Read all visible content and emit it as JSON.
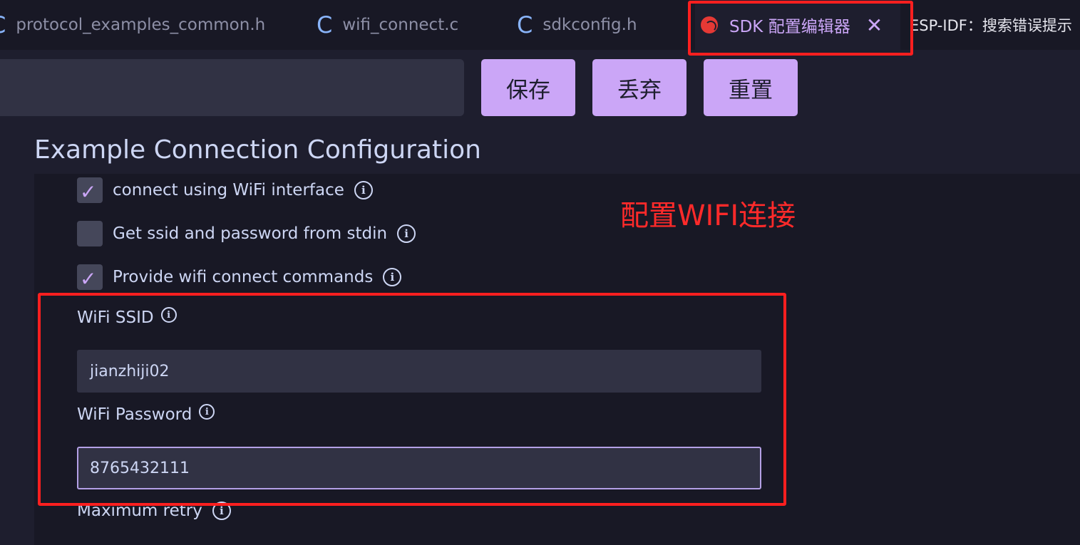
{
  "tabs": [
    {
      "label": "protocol_examples_common.h",
      "icon": "c-file-icon"
    },
    {
      "label": "wifi_connect.c",
      "icon": "c-file-icon"
    },
    {
      "label": "sdkconfig.h",
      "icon": "c-file-icon"
    },
    {
      "label": "SDK 配置编辑器",
      "icon": "espressif-icon",
      "active": true,
      "close_symbol": "✕"
    }
  ],
  "right_tab_label": "ESP-IDF：搜索错误提示",
  "toolbar": {
    "search_value": "",
    "save_label": "保存",
    "discard_label": "丢弃",
    "reset_label": "重置"
  },
  "section": {
    "title": "Example Connection Configuration",
    "options": [
      {
        "label": "connect using WiFi interface",
        "checked": true
      },
      {
        "label": "Get ssid and password from stdin",
        "checked": false
      },
      {
        "label": "Provide wifi connect commands",
        "checked": true
      }
    ],
    "ssid": {
      "label": "WiFi SSID",
      "value": "jianzhiji02"
    },
    "password": {
      "label": "WiFi Password",
      "value": "8765432111"
    },
    "max_retry": {
      "label": "Maximum retry"
    }
  },
  "annotation": {
    "text": "配置WIFI连接",
    "color": "#ff1f1f"
  },
  "colors": {
    "accent": "#cba6f7",
    "background": "#1e1e2e",
    "panel": "#181825",
    "input": "#313244"
  }
}
